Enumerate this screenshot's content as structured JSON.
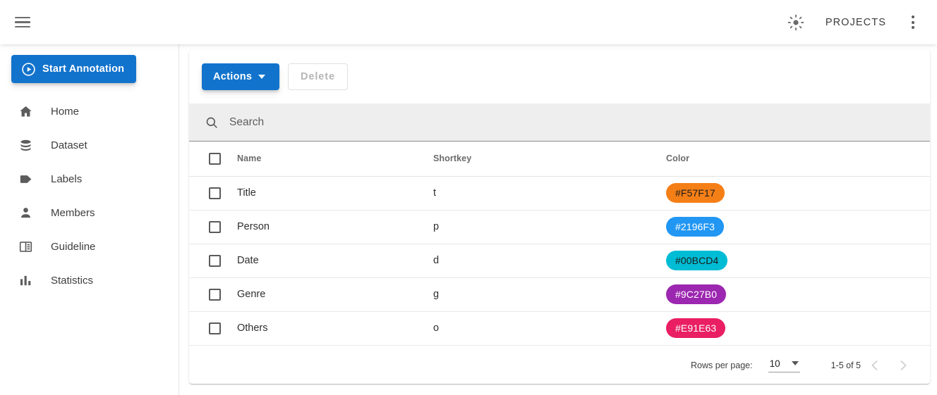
{
  "appbar": {
    "menu_icon": "hamburger-menu-icon",
    "brightness_icon": "brightness-sun-icon",
    "projects_label": "PROJECTS",
    "overflow_icon": "more-vertical-icon"
  },
  "sidebar": {
    "start_button": {
      "label": "Start Annotation",
      "icon": "play-circle-icon",
      "color": "#1273cc"
    },
    "items": [
      {
        "label": "Home",
        "icon": "home-icon"
      },
      {
        "label": "Dataset",
        "icon": "database-icon"
      },
      {
        "label": "Labels",
        "icon": "tag-icon"
      },
      {
        "label": "Members",
        "icon": "person-icon"
      },
      {
        "label": "Guideline",
        "icon": "book-icon"
      },
      {
        "label": "Statistics",
        "icon": "bar-chart-icon"
      }
    ]
  },
  "toolbar": {
    "actions_label": "Actions",
    "delete_label": "Delete",
    "delete_disabled": true
  },
  "search": {
    "placeholder": "Search",
    "value": "",
    "icon": "search-icon"
  },
  "table": {
    "columns": [
      "Name",
      "Shortkey",
      "Color"
    ],
    "rows": [
      {
        "name": "Title",
        "shortkey": "t",
        "color": "#F57F17",
        "text_color": "#1b1b1b"
      },
      {
        "name": "Person",
        "shortkey": "p",
        "color": "#2196F3",
        "text_color": "#ffffff"
      },
      {
        "name": "Date",
        "shortkey": "d",
        "color": "#00BCD4",
        "text_color": "#1b1b1b"
      },
      {
        "name": "Genre",
        "shortkey": "g",
        "color": "#9C27B0",
        "text_color": "#ffffff"
      },
      {
        "name": "Others",
        "shortkey": "o",
        "color": "#E91E63",
        "text_color": "#ffffff"
      }
    ]
  },
  "pagination": {
    "rows_per_page_label": "Rows per page:",
    "rows_per_page_value": "10",
    "range_label": "1-5 of 5",
    "prev_icon": "chevron-left-icon",
    "next_icon": "chevron-right-icon",
    "prev_disabled": true,
    "next_disabled": true
  }
}
